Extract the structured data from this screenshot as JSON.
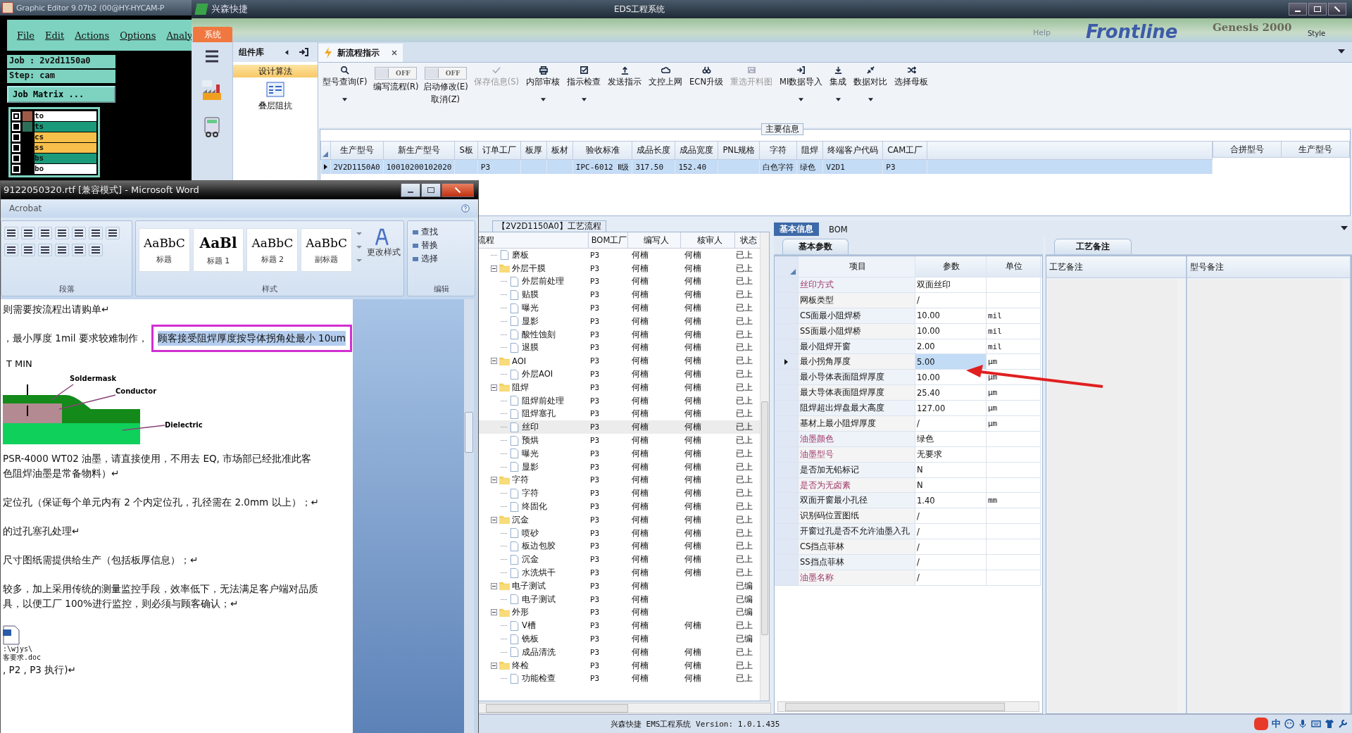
{
  "graphic_editor": {
    "title": "Graphic Editor 9.07b2 (00@HY-HYCAM-P",
    "menu": [
      "File",
      "Edit",
      "Actions",
      "Options",
      "Analy"
    ],
    "job": "Job : 2v2d1150a0",
    "step": "Step: cam",
    "job_matrix": "Job Matrix ...",
    "layers": [
      {
        "name": "to",
        "color": "#ffffff",
        "checked": true,
        "swatch": {
          "color": "#a05a48"
        }
      },
      {
        "name": "ts",
        "color": "#1a9a7a",
        "checked": false,
        "swatch": {
          "color": "#2d6e58"
        }
      },
      {
        "name": "cs",
        "color": "#f7c04a",
        "checked": false
      },
      {
        "name": "ss",
        "color": "#f7c04a",
        "checked": false
      },
      {
        "name": "bs",
        "color": "#1a9a7a",
        "checked": false
      },
      {
        "name": "bo",
        "color": "#ffffff",
        "checked": false
      }
    ]
  },
  "eds": {
    "app_name": "兴森快捷",
    "title": "EDS工程系统",
    "menu_tabs": [
      {
        "label": "系统",
        "selected": true
      }
    ],
    "backdrop_texts": [
      "Help",
      "Frontline",
      "Genesis 2000",
      "Style"
    ],
    "component_library": {
      "title": "组件库",
      "items": [
        {
          "label": "设计算法",
          "selected": true
        }
      ],
      "tools": [
        "叠层阻抗"
      ]
    },
    "document_tabs": [
      {
        "label": "新流程指示",
        "selected": true
      }
    ],
    "toolbar": [
      {
        "kind": "button",
        "label": "型号查询(F)",
        "dropdown": true,
        "disabled": false
      },
      {
        "kind": "toggle",
        "label": "编写流程(R)",
        "state": "OFF",
        "on": false
      },
      {
        "kind": "toggle",
        "label": "启动修改(E)",
        "label_2": "取消(Z)",
        "state": "OFF",
        "on": false
      },
      {
        "kind": "button",
        "label": "保存信息(S)",
        "dropdown": false,
        "disabled": true
      },
      {
        "kind": "button",
        "label": "内部审核",
        "dropdown": true,
        "disabled": false
      },
      {
        "kind": "button",
        "label": "指示检查",
        "dropdown": true,
        "disabled": false
      },
      {
        "kind": "button",
        "label": "发送指示",
        "dropdown": false,
        "disabled": false
      },
      {
        "kind": "button",
        "label": "文控上网",
        "dropdown": false,
        "disabled": false
      },
      {
        "kind": "button",
        "label": "ECN升级",
        "dropdown": false,
        "disabled": false
      },
      {
        "kind": "button",
        "label": "重选开料图",
        "dropdown": false,
        "disabled": true
      },
      {
        "kind": "button",
        "label": "MI数据导入",
        "dropdown": true,
        "disabled": false
      },
      {
        "kind": "button",
        "label": "集成",
        "dropdown": true,
        "disabled": false
      },
      {
        "kind": "button",
        "label": "数据对比",
        "dropdown": true,
        "disabled": false
      },
      {
        "kind": "button",
        "label": "选择母板",
        "dropdown": false,
        "disabled": false
      }
    ],
    "main_info": {
      "title": "主要信息",
      "columns": [
        "生产型号",
        "新生产型号",
        "S板",
        "订单工厂",
        "板厚",
        "板材",
        "验收标准",
        "成品长度",
        "成品宽度",
        "PNL规格",
        "字符",
        "阻焊",
        "终端客户代码",
        "CAM工厂"
      ],
      "rows": [
        {
          "selected": true,
          "cells": [
            "2V2D1150A0",
            "10010200102020",
            null,
            "P3",
            null,
            null,
            "IPC-6012 Ⅱ级",
            "317.50",
            "152.40",
            null,
            "白色字符",
            "绿色",
            "V2D1",
            "P3"
          ]
        }
      ],
      "side_columns": [
        "合拼型号",
        "生产型号"
      ]
    },
    "process": {
      "title": "【2V2D1150A0】工艺流程",
      "columns": [
        "流程",
        "BOM工厂",
        "编写人",
        "核审人",
        "状态"
      ],
      "rows": [
        {
          "kind": "file",
          "name": "磨板",
          "factory": "P3",
          "writer": "何楠",
          "reviewer": "何楠",
          "status": "已上",
          "selected": false
        },
        {
          "kind": "folder",
          "name": "外层干膜",
          "factory": "P3",
          "writer": "何楠",
          "reviewer": "何楠",
          "status": "已上",
          "selected": false,
          "expanded": true,
          "children": [
            {
              "kind": "file",
              "name": "外层前处理",
              "factory": "P3",
              "writer": "何楠",
              "reviewer": "何楠",
              "status": "已上",
              "selected": false
            },
            {
              "kind": "file",
              "name": "贴膜",
              "factory": "P3",
              "writer": "何楠",
              "reviewer": "何楠",
              "status": "已上",
              "selected": false
            },
            {
              "kind": "file",
              "name": "曝光",
              "factory": "P3",
              "writer": "何楠",
              "reviewer": "何楠",
              "status": "已上",
              "selected": false
            },
            {
              "kind": "file",
              "name": "显影",
              "factory": "P3",
              "writer": "何楠",
              "reviewer": "何楠",
              "status": "已上",
              "selected": false
            },
            {
              "kind": "file",
              "name": "酸性蚀刻",
              "factory": "P3",
              "writer": "何楠",
              "reviewer": "何楠",
              "status": "已上",
              "selected": false
            },
            {
              "kind": "file",
              "name": "退膜",
              "factory": "P3",
              "writer": "何楠",
              "reviewer": "何楠",
              "status": "已上",
              "selected": false
            }
          ]
        },
        {
          "kind": "folder",
          "name": "AOI",
          "factory": "P3",
          "writer": "何楠",
          "reviewer": "何楠",
          "status": "已上",
          "selected": false,
          "expanded": true,
          "children": [
            {
              "kind": "file",
              "name": "外层AOI",
              "factory": "P3",
              "writer": "何楠",
              "reviewer": "何楠",
              "status": "已上",
              "selected": false
            }
          ]
        },
        {
          "kind": "folder",
          "name": "阻焊",
          "factory": "P3",
          "writer": "何楠",
          "reviewer": "何楠",
          "status": "已上",
          "selected": false,
          "expanded": true,
          "children": [
            {
              "kind": "file",
              "name": "阻焊前处理",
              "factory": "P3",
              "writer": "何楠",
              "reviewer": "何楠",
              "status": "已上",
              "selected": false
            },
            {
              "kind": "file",
              "name": "阻焊塞孔",
              "factory": "P3",
              "writer": "何楠",
              "reviewer": "何楠",
              "status": "已上",
              "selected": false
            },
            {
              "kind": "file",
              "name": "丝印",
              "factory": "P3",
              "writer": "何楠",
              "reviewer": "何楠",
              "status": "已上",
              "selected": true
            },
            {
              "kind": "file",
              "name": "预烘",
              "factory": "P3",
              "writer": "何楠",
              "reviewer": "何楠",
              "status": "已上",
              "selected": false
            },
            {
              "kind": "file",
              "name": "曝光",
              "factory": "P3",
              "writer": "何楠",
              "reviewer": "何楠",
              "status": "已上",
              "selected": false
            },
            {
              "kind": "file",
              "name": "显影",
              "factory": "P3",
              "writer": "何楠",
              "reviewer": "何楠",
              "status": "已上",
              "selected": false
            }
          ]
        },
        {
          "kind": "folder",
          "name": "字符",
          "factory": "P3",
          "writer": "何楠",
          "reviewer": "何楠",
          "status": "已上",
          "selected": false,
          "expanded": true,
          "children": [
            {
              "kind": "file",
              "name": "字符",
              "factory": "P3",
              "writer": "何楠",
              "reviewer": "何楠",
              "status": "已上",
              "selected": false
            },
            {
              "kind": "file",
              "name": "终固化",
              "factory": "P3",
              "writer": "何楠",
              "reviewer": "何楠",
              "status": "已上",
              "selected": false
            }
          ]
        },
        {
          "kind": "folder",
          "name": "沉金",
          "factory": "P3",
          "writer": "何楠",
          "reviewer": "何楠",
          "status": "已上",
          "selected": false,
          "expanded": true,
          "children": [
            {
              "kind": "file",
              "name": "喷砂",
              "factory": "P3",
              "writer": "何楠",
              "reviewer": "何楠",
              "status": "已上",
              "selected": false
            },
            {
              "kind": "file",
              "name": "板边包胶",
              "factory": "P3",
              "writer": "何楠",
              "reviewer": "何楠",
              "status": "已上",
              "selected": false
            },
            {
              "kind": "file",
              "name": "沉金",
              "factory": "P3",
              "writer": "何楠",
              "reviewer": "何楠",
              "status": "已上",
              "selected": false
            },
            {
              "kind": "file",
              "name": "水洗烘干",
              "factory": "P3",
              "writer": "何楠",
              "reviewer": "何楠",
              "status": "已上",
              "selected": false
            }
          ]
        },
        {
          "kind": "folder",
          "name": "电子测试",
          "factory": "P3",
          "writer": "何楠",
          "status": "已编",
          "selected": false,
          "expanded": true,
          "children": [
            {
              "kind": "file",
              "name": "电子测试",
              "factory": "P3",
              "writer": "何楠",
              "status": "已编",
              "selected": false
            }
          ]
        },
        {
          "kind": "folder",
          "name": "外形",
          "factory": "P3",
          "writer": "何楠",
          "status": "已编",
          "selected": false,
          "expanded": true,
          "children": [
            {
              "kind": "file",
              "name": "V槽",
              "factory": "P3",
              "writer": "何楠",
              "reviewer": "何楠",
              "status": "已上",
              "selected": false
            },
            {
              "kind": "file",
              "name": "铣板",
              "factory": "P3",
              "writer": "何楠",
              "status": "已编",
              "selected": false
            },
            {
              "kind": "file",
              "name": "成品清洗",
              "factory": "P3",
              "writer": "何楠",
              "reviewer": "何楠",
              "status": "已上",
              "selected": false
            }
          ]
        },
        {
          "kind": "folder",
          "name": "终检",
          "factory": "P3",
          "writer": "何楠",
          "reviewer": "何楠",
          "status": "已上",
          "selected": false,
          "expanded": true,
          "children": [
            {
              "kind": "file",
              "name": "功能检查",
              "factory": "P3",
              "writer": "何楠",
              "reviewer": "何楠",
              "status": "已上",
              "selected": false
            }
          ]
        }
      ]
    },
    "info_tabs": [
      {
        "label": "基本信息",
        "selected": true
      },
      {
        "label": "BOM",
        "selected": false
      }
    ],
    "params": {
      "tab": "基本参数",
      "columns": [
        "项目",
        "参数",
        "单位"
      ],
      "rows": [
        {
          "item": "丝印方式",
          "value": "双面丝印",
          "required": true,
          "selected": false
        },
        {
          "item": "网板类型",
          "value": "/",
          "required": false,
          "selected": false
        },
        {
          "item": "CS面最小阻焊桥",
          "value": "10.00",
          "unit": "mil",
          "required": false,
          "selected": false
        },
        {
          "item": "SS面最小阻焊桥",
          "value": "10.00",
          "unit": "mil",
          "required": false,
          "selected": false
        },
        {
          "item": "最小阻焊开窗",
          "value": "2.00",
          "unit": "mil",
          "required": false,
          "selected": false
        },
        {
          "item": "最小拐角厚度",
          "value": "5.00",
          "unit": "µm",
          "required": false,
          "selected": true
        },
        {
          "item": "最小导体表面阻焊厚度",
          "value": "10.00",
          "unit": "µm",
          "required": false,
          "selected": false
        },
        {
          "item": "最大导体表面阻焊厚度",
          "value": "25.40",
          "unit": "µm",
          "required": false,
          "selected": false
        },
        {
          "item": "阻焊超出焊盘最大高度",
          "value": "127.00",
          "unit": "µm",
          "required": false,
          "selected": false
        },
        {
          "item": "基材上最小阻焊厚度",
          "value": "/",
          "unit": "µm",
          "required": false,
          "selected": false
        },
        {
          "item": "油墨颜色",
          "value": "绿色",
          "required": true,
          "selected": false
        },
        {
          "item": "油墨型号",
          "value": "无要求",
          "required": true,
          "selected": false
        },
        {
          "item": "是否加无铅标记",
          "value": "N",
          "required": false,
          "selected": false
        },
        {
          "item": "是否为无卤素",
          "value": "N",
          "required": true,
          "selected": false
        },
        {
          "item": "双面开窗最小孔径",
          "value": "1.40",
          "unit": "mm",
          "required": false,
          "selected": false
        },
        {
          "item": "识别码位置图纸",
          "value": "/",
          "required": false,
          "selected": false
        },
        {
          "item": "开窗过孔是否不允许油墨入孔",
          "value": "/",
          "required": false,
          "selected": false
        },
        {
          "item": "CS挡点菲林",
          "value": "/",
          "required": false,
          "selected": false
        },
        {
          "item": "SS挡点菲林",
          "value": "/",
          "required": false,
          "selected": false
        },
        {
          "item": "油墨名称",
          "value": "/",
          "required": true,
          "selected": false
        }
      ]
    },
    "notes": {
      "tab": "工艺备注",
      "columns": [
        "工艺备注",
        "型号备注"
      ]
    },
    "status_bar": "兴森快捷 EMS工程系统 Version: 1.0.1.435",
    "ime_label": "中"
  },
  "word": {
    "title": "9122050320.rtf [兼容模式] - Microsoft Word",
    "ribbon_tab": "Acrobat",
    "styles": [
      {
        "sample": "AaBbC",
        "name": "标题",
        "bold": false
      },
      {
        "sample": "AaBl",
        "name": "标题 1",
        "bold": true
      },
      {
        "sample": "AaBbC",
        "name": "标题 2",
        "bold": false
      },
      {
        "sample": "AaBbC",
        "name": "副标题",
        "bold": false
      }
    ],
    "change_styles": "更改样式",
    "edit_actions": [
      "查找",
      "替换",
      "选择"
    ],
    "groups": [
      "段落",
      "样式",
      "编辑"
    ],
    "paragraphs": [
      {
        "kind": "text",
        "lines": [
          "则需要按流程出请购单↵"
        ]
      },
      {
        "kind": "highlight",
        "text": "，最小厚度 1mil 要求较难制作，",
        "highlight": "顾客接受阻焊厚度按导体拐角处最小 10um"
      },
      {
        "kind": "figure",
        "labels": [
          "T MIN",
          "Soldermask",
          "Conductor",
          "Dielectric"
        ]
      },
      {
        "kind": "text",
        "lines": [
          "PSR-4000 WT02 油墨，请直接使用，不用去 EQ, 市场部已经批准此客",
          "色阻焊油墨是常备物料）↵"
        ]
      },
      {
        "kind": "text",
        "lines": [
          "定位孔（保证每个单元内有 2 个内定位孔，孔径需在 2.0mm 以上）；↵"
        ]
      },
      {
        "kind": "text",
        "lines": [
          "的过孔塞孔处理↵"
        ]
      },
      {
        "kind": "text",
        "lines": [
          "尺寸图纸需提供给生产（包括板厚信息）；↵"
        ]
      },
      {
        "kind": "text",
        "lines": [
          "较多，加上采用传统的测量监控手段，效率低下，无法满足客户端对品质",
          "具，以便工厂 100%进行监控，则必须与顾客确认；↵"
        ]
      },
      {
        "kind": "attachment",
        "path": ":\\wjys\\",
        "file": "客要求.doc"
      },
      {
        "kind": "text",
        "lines": [
          ", P2 , P3 执行)↵"
        ]
      }
    ]
  }
}
